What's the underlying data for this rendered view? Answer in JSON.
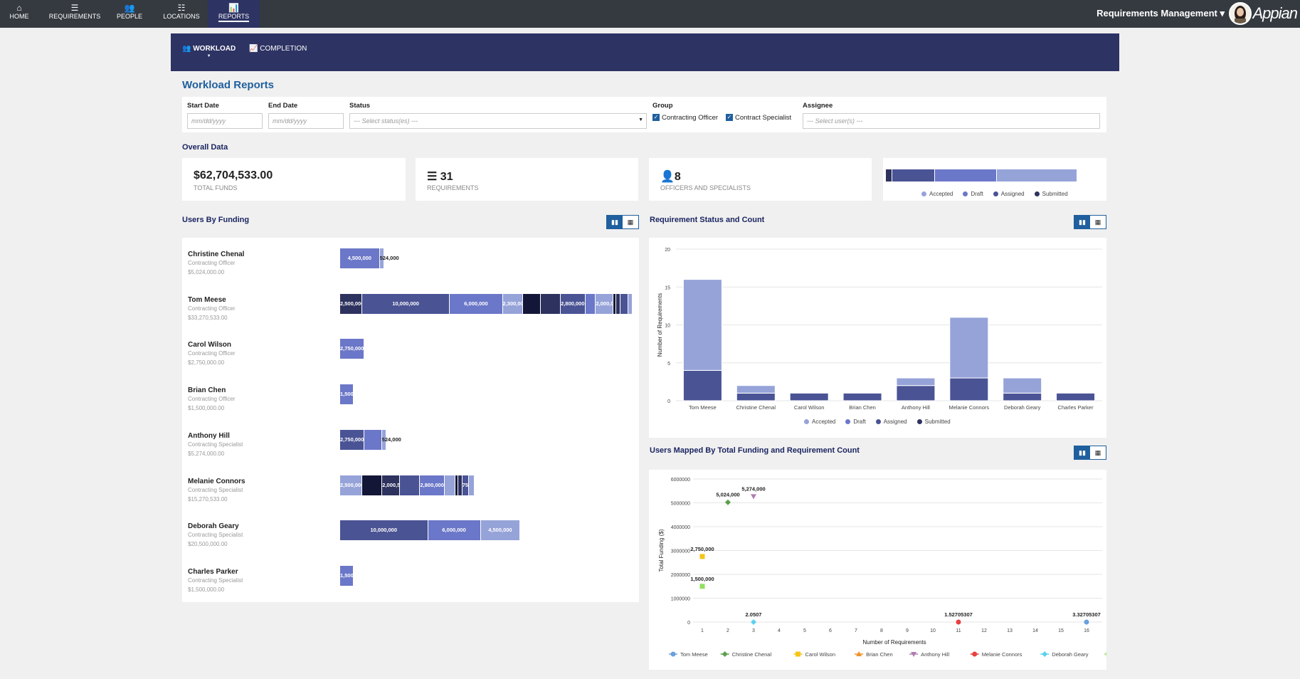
{
  "nav": {
    "items": [
      {
        "label": "HOME",
        "icon": "home-icon",
        "glyph": "⌂"
      },
      {
        "label": "REQUIREMENTS",
        "icon": "list-icon",
        "glyph": "☰"
      },
      {
        "label": "PEOPLE",
        "icon": "people-icon",
        "glyph": "👥"
      },
      {
        "label": "LOCATIONS",
        "icon": "list-bullets-icon",
        "glyph": "☷"
      },
      {
        "label": "REPORTS",
        "icon": "bar-chart-icon",
        "glyph": "📊",
        "active": true
      }
    ],
    "app_name": "Requirements Management ▾",
    "logo": "Appian"
  },
  "tabs": [
    {
      "label": "WORKLOAD",
      "icon": "users-icon",
      "active": true
    },
    {
      "label": "COMPLETION",
      "icon": "line-chart-icon"
    }
  ],
  "page_title": "Workload Reports",
  "filters": {
    "start_date": {
      "label": "Start Date",
      "placeholder": "mm/dd/yyyy"
    },
    "end_date": {
      "label": "End Date",
      "placeholder": "mm/dd/yyyy"
    },
    "status": {
      "label": "Status",
      "placeholder": "--- Select status(es) ---"
    },
    "group": {
      "label": "Group",
      "options": [
        {
          "label": "Contracting Officer",
          "checked": true
        },
        {
          "label": "Contract Specialist",
          "checked": true
        }
      ]
    },
    "assignee": {
      "label": "Assignee",
      "placeholder": "--- Select user(s) ---"
    }
  },
  "overall": {
    "title": "Overall Data",
    "total_funds": {
      "value": "$62,704,533.00",
      "label": "TOTAL FUNDS"
    },
    "requirements": {
      "value": "31",
      "label": "REQUIREMENTS"
    },
    "officers": {
      "value": "8",
      "label": "OFFICERS AND SPECIALISTS"
    },
    "status_bar": [
      {
        "status": "Submitted",
        "value": 1
      },
      {
        "status": "Assigned",
        "value": 7
      },
      {
        "status": "Draft",
        "value": 10
      },
      {
        "status": "Accepted",
        "value": 13
      }
    ]
  },
  "colors": {
    "Accepted": "#96a3d9",
    "Draft": "#6b77c8",
    "Assigned": "#4a5394",
    "Submitted": "#2d325e",
    "Dark": "#141638",
    "accent": "#1f5f9e"
  },
  "legend_statuses": [
    "Accepted",
    "Draft",
    "Assigned",
    "Submitted"
  ],
  "users_by_funding": {
    "title": "Users By Funding",
    "users": [
      {
        "name": "Christine Chenal",
        "role": "Contracting Officer",
        "total": "$5,024,000.00",
        "segments": [
          [
            4500000,
            "Draft",
            true
          ],
          [
            524000,
            "Accepted",
            true
          ]
        ]
      },
      {
        "name": "Tom Meese",
        "role": "Contracting Officer",
        "total": "$33,270,533.00",
        "segments": [
          [
            2500000,
            "Submitted",
            true
          ],
          [
            10000000,
            "Assigned",
            true
          ],
          [
            6000000,
            "Draft",
            true
          ],
          [
            2300000,
            "Accepted",
            true
          ],
          [
            2000000,
            "Dark",
            false
          ],
          [
            2300000,
            "Submitted",
            false
          ],
          [
            2800000,
            "Assigned",
            true
          ],
          [
            1200000,
            "Draft",
            false
          ],
          [
            2000000,
            "Accepted",
            true
          ],
          [
            300000,
            "Dark",
            false
          ],
          [
            500000,
            "Submitted",
            false
          ],
          [
            870533,
            "Assigned",
            false
          ],
          [
            500000,
            "Accepted",
            false
          ]
        ]
      },
      {
        "name": "Carol Wilson",
        "role": "Contracting Officer",
        "total": "$2,750,000.00",
        "segments": [
          [
            2750000,
            "Draft",
            true
          ]
        ]
      },
      {
        "name": "Brian Chen",
        "role": "Contracting Officer",
        "total": "$1,500,000.00",
        "segments": [
          [
            1500000,
            "Draft",
            true
          ]
        ]
      },
      {
        "name": "Anthony Hill",
        "role": "Contracting Specialist",
        "total": "$5,274,000.00",
        "segments": [
          [
            2750000,
            "Assigned",
            true
          ],
          [
            2000000,
            "Draft",
            false
          ],
          [
            524000,
            "Accepted",
            true
          ]
        ]
      },
      {
        "name": "Melanie Connors",
        "role": "Contracting Specialist",
        "total": "$15,270,533.00",
        "segments": [
          [
            2500000,
            "Accepted",
            true
          ],
          [
            2300000,
            "Dark",
            false
          ],
          [
            2000533,
            "Submitted",
            true
          ],
          [
            2300000,
            "Assigned",
            false
          ],
          [
            2800000,
            "Draft",
            true
          ],
          [
            1200000,
            "Accepted",
            false
          ],
          [
            300000,
            "Dark",
            false
          ],
          [
            500000,
            "Submitted",
            false
          ],
          [
            750000,
            "Assigned",
            true
          ],
          [
            620000,
            "Accepted",
            false
          ]
        ]
      },
      {
        "name": "Deborah Geary",
        "role": "Contracting Specialist",
        "total": "$20,500,000.00",
        "segments": [
          [
            10000000,
            "Assigned",
            true
          ],
          [
            6000000,
            "Draft",
            true
          ],
          [
            4500000,
            "Accepted",
            true
          ]
        ]
      },
      {
        "name": "Charles Parker",
        "role": "Contracting Specialist",
        "total": "$1,500,000.00",
        "segments": [
          [
            1500000,
            "Draft",
            true
          ]
        ]
      }
    ]
  },
  "chart_data": [
    {
      "type": "bar",
      "stacked": true,
      "title": "Requirement Status and Count",
      "ylabel": "Number of Requirements",
      "ylim": [
        0,
        20
      ],
      "yticks": [
        0,
        5,
        10,
        15,
        20
      ],
      "grid": true,
      "legend": "bottom",
      "categories": [
        "Tom Meese",
        "Christine Chenal",
        "Carol Wilson",
        "Brian Chen",
        "Anthony Hill",
        "Melanie Connors",
        "Deborah Geary",
        "Charles Parker"
      ],
      "series": [
        {
          "name": "Submitted",
          "values": [
            0,
            0,
            0,
            0,
            0,
            0,
            0,
            0
          ]
        },
        {
          "name": "Assigned",
          "values": [
            4,
            1,
            1,
            1,
            2,
            3,
            1,
            1
          ]
        },
        {
          "name": "Draft",
          "values": [
            0,
            0,
            0,
            0,
            0,
            0,
            0,
            0
          ]
        },
        {
          "name": "Accepted",
          "values": [
            12,
            1,
            0,
            0,
            1,
            8,
            2,
            0
          ]
        }
      ]
    },
    {
      "type": "scatter",
      "title": "Users Mapped By Total Funding and Requirement Count",
      "xlabel": "Number of Requirements",
      "ylabel": "Total Funding ($)",
      "xlim": [
        1,
        16
      ],
      "ylim": [
        0,
        6000000
      ],
      "yticks": [
        "0",
        "1000000",
        "2000000",
        "3000000",
        "4000000",
        "5000000",
        "6000000"
      ],
      "xticks": [
        1,
        2,
        3,
        4,
        5,
        6,
        7,
        8,
        9,
        10,
        11,
        12,
        13,
        14,
        15,
        16
      ],
      "grid": true,
      "legend": "bottom",
      "series": [
        {
          "name": "Tom Meese",
          "x": 16,
          "y": 3.32705307,
          "label": "3.32705307",
          "color": "#6aa0dd",
          "marker": "circle"
        },
        {
          "name": "Christine Chenal",
          "x": 2,
          "y": 5024000,
          "label": "5,024,000",
          "color": "#5aa04a",
          "marker": "diamond"
        },
        {
          "name": "Carol Wilson",
          "x": 1,
          "y": 2750000,
          "label": "2,750,000",
          "color": "#f5c518",
          "marker": "square"
        },
        {
          "name": "Brian Chen",
          "x": 1,
          "y": 1500000,
          "label": "",
          "color": "#f0932b",
          "marker": "triangle"
        },
        {
          "name": "Anthony Hill",
          "x": 3,
          "y": 5274000,
          "label": "5,274,000",
          "color": "#b07cb0",
          "marker": "triangle-down"
        },
        {
          "name": "Melanie Connors",
          "x": 11,
          "y": 1.52705307,
          "label": "1.52705307",
          "color": "#e84040",
          "marker": "circle"
        },
        {
          "name": "Deborah Geary",
          "x": 3,
          "y": 2.0507,
          "label": "2.0507",
          "color": "#5bd0f0",
          "marker": "diamond"
        },
        {
          "name": "Charles Parker",
          "x": 1,
          "y": 1500000,
          "label": "1,500,000",
          "color": "#90e060",
          "marker": "square"
        }
      ]
    }
  ],
  "toggle": {
    "chart_icon": "▮▮",
    "grid_icon": "▦"
  }
}
